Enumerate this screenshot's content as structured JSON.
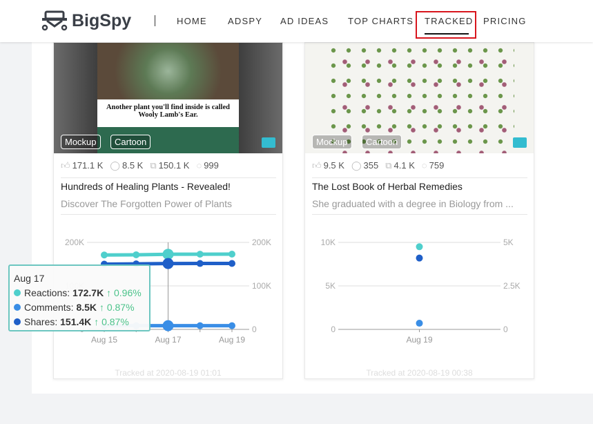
{
  "header": {
    "logo": "BigSpy",
    "nav": [
      "HOME",
      "ADSPY",
      "AD IDEAS",
      "TOP CHARTS",
      "TRACKED",
      "PRICING"
    ],
    "active": "TRACKED"
  },
  "colors": {
    "reactions": "#4fcfcc",
    "comments": "#3a8ee6",
    "shares": "#1f5fc8",
    "highlight": "#d8141c"
  },
  "cards": [
    {
      "image_caption": "Another plant you'll find inside is called Wooly Lamb's Ear.",
      "tags": [
        "Mockup",
        "Cartoon"
      ],
      "stats": {
        "likes": "171.1 K",
        "comments": "8.5 K",
        "shares": "150.1 K",
        "views": "999"
      },
      "title": "Hundreds of Healing Plants - Revealed!",
      "description": "Discover The Forgotten Power of Plants",
      "tracked_at": "Tracked at 2020-08-19 01:01"
    },
    {
      "tags": [
        "Mockup",
        "Cartoon"
      ],
      "stats": {
        "likes": "9.5 K",
        "comments": "355",
        "shares": "4.1 K",
        "views": "759"
      },
      "title": "The Lost Book of Herbal Remedies",
      "description": "She graduated with a degree in Biology from ...",
      "tracked_at": "Tracked at 2020-08-19 00:38"
    }
  ],
  "chart_data": [
    {
      "type": "line",
      "x": [
        "Aug 15",
        "Aug 16",
        "Aug 17",
        "Aug 18",
        "Aug 19"
      ],
      "xticks": [
        "Aug 15",
        "Aug 17",
        "Aug 19"
      ],
      "yleft": {
        "range": [
          0,
          200000
        ],
        "ticks": [
          "0",
          "100K",
          "200K"
        ]
      },
      "yright": {
        "range": [
          0,
          200000
        ],
        "ticks": [
          "0",
          "100K",
          "200K"
        ]
      },
      "series": [
        {
          "name": "Reactions",
          "values": [
            171000,
            171500,
            172700,
            172900,
            173000
          ]
        },
        {
          "name": "Comments",
          "values": [
            8400,
            8450,
            8500,
            8500,
            8500
          ]
        },
        {
          "name": "Shares",
          "values": [
            150000,
            150500,
            151400,
            151500,
            151600
          ]
        }
      ],
      "tooltip": {
        "date": "Aug 17",
        "rows": [
          {
            "label": "Reactions: ",
            "value": "172.7K",
            "change": "↑ 0.96%"
          },
          {
            "label": "Comments: ",
            "value": "8.5K",
            "change": "↑ 0.87%"
          },
          {
            "label": "Shares: ",
            "value": "151.4K",
            "change": "↑ 0.87%"
          }
        ]
      }
    },
    {
      "type": "scatter",
      "x": [
        "Aug 19"
      ],
      "xticks": [
        "Aug 19"
      ],
      "yleft": {
        "range": [
          0,
          10000
        ],
        "ticks": [
          "0",
          "5K",
          "10K"
        ]
      },
      "yright": {
        "range": [
          0,
          5000
        ],
        "ticks": [
          "0",
          "2.5K",
          "5K"
        ]
      },
      "series": [
        {
          "name": "Reactions",
          "values": [
            9500
          ],
          "axis": "left"
        },
        {
          "name": "Comments",
          "values": [
            355
          ],
          "axis": "right"
        },
        {
          "name": "Shares",
          "values": [
            4100
          ],
          "axis": "right"
        }
      ]
    }
  ]
}
